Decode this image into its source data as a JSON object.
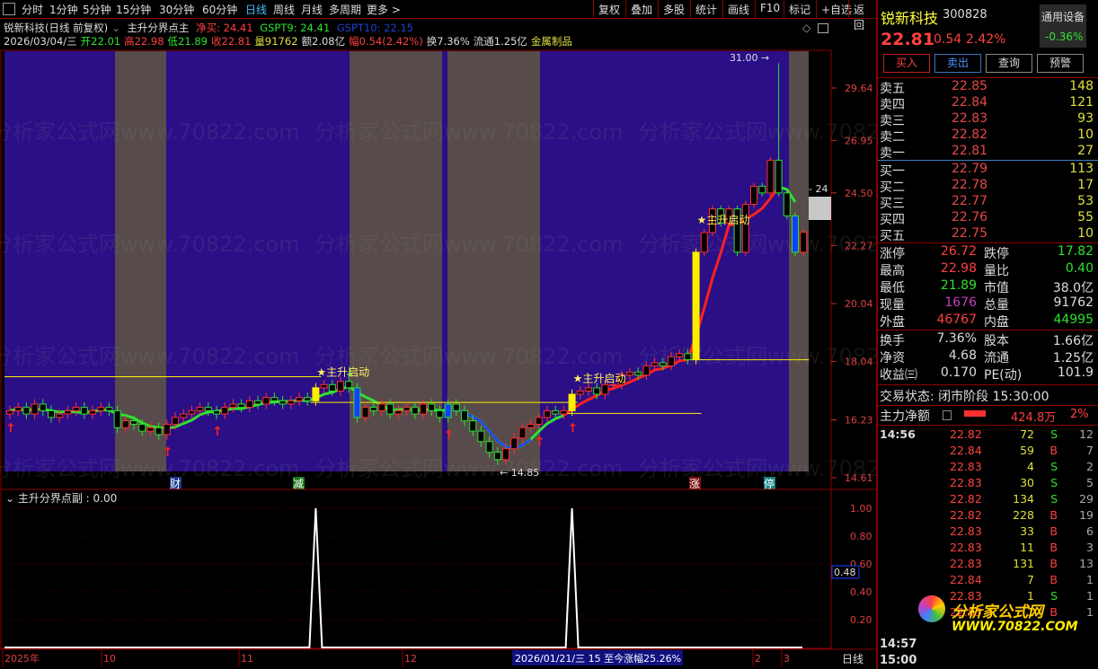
{
  "toolbar": {
    "periods": [
      "分时",
      "1分钟",
      "5分钟",
      "15分钟",
      "30分钟",
      "60分钟",
      "日线",
      "周线",
      "月线",
      "多周期",
      "更多 >"
    ],
    "active": "日线",
    "actions": [
      "复权",
      "叠加",
      "多股",
      "统计",
      "画线",
      "F10",
      "标记",
      "+自选",
      "返回"
    ]
  },
  "info": {
    "title": "锐新科技(日线 前复权)",
    "indicator": "主升分界点主",
    "jm": "净买: 24.41",
    "gspt9": "GSPT9: 24.41",
    "gspt10": "GSPT10: 22.15",
    "date": "2026/03/04/三",
    "open": "开22.01",
    "high": "高22.98",
    "low": "低21.89",
    "close": "收22.81",
    "vol": "量91762",
    "amount": "额2.08亿",
    "change": "幅0.54(2.42%)",
    "turnover": "换7.36%",
    "float": "流通1.25亿",
    "sector": "金属制品"
  },
  "chart_labels": {
    "signal": "★主升启动",
    "max_label": "31.00",
    "min_label": "← 14.85",
    "side_label": "- 24",
    "markers": [
      "财",
      "减",
      "涨",
      "停"
    ]
  },
  "sub": {
    "title": "主升分界点副 : 0.00",
    "current": "0.48",
    "ticks": [
      "1.00",
      "0.80",
      "0.60",
      "0.40",
      "0.20"
    ]
  },
  "axis": {
    "price_ticks": [
      "29.64",
      "26.95",
      "24.50",
      "22.27",
      "20.04",
      "18.04",
      "16.23",
      "14.61"
    ],
    "dates": [
      "2025年",
      "10",
      "11",
      "12",
      "2",
      "3"
    ],
    "cursor": "2026/01/21/三 15 至今涨幅25.26%",
    "period": "日线"
  },
  "watermark": "分析家公式网www.70822.com",
  "chart_data": {
    "type": "candlestick",
    "closes": [
      16.5,
      16.6,
      16.4,
      16.7,
      16.5,
      16.3,
      16.4,
      16.5,
      16.6,
      16.4,
      16.5,
      16.6,
      16.5,
      16.0,
      16.2,
      16.1,
      15.9,
      16.0,
      15.8,
      16.1,
      16.3,
      16.4,
      16.5,
      16.6,
      16.5,
      16.4,
      16.6,
      16.7,
      16.6,
      16.8,
      16.7,
      16.9,
      16.8,
      16.7,
      16.8,
      16.9,
      16.8,
      17.2,
      17.3,
      17.1,
      17.4,
      17.2,
      16.3,
      16.6,
      16.5,
      16.7,
      16.4,
      16.5,
      16.6,
      16.4,
      16.7,
      16.5,
      16.3,
      16.7,
      16.5,
      16.2,
      15.9,
      15.6,
      15.3,
      15.1,
      15.4,
      15.7,
      16.0,
      16.1,
      16.3,
      16.5,
      16.4,
      16.5,
      17.0,
      17.1,
      17.2,
      17.0,
      17.3,
      17.3,
      17.6,
      17.7,
      17.6,
      17.9,
      18.0,
      17.9,
      18.2,
      18.3,
      18.1,
      22.0,
      22.8,
      23.8,
      23.2,
      23.8,
      22.0,
      24.0,
      24.8,
      24.5,
      26.0,
      24.5,
      23.5,
      22.0,
      22.81
    ],
    "high_override": {
      "93": 31.0
    },
    "yellow": [
      37,
      68,
      83
    ],
    "blue": [
      42,
      53,
      95
    ],
    "up_arrows": [
      0,
      19,
      25,
      53,
      64,
      68
    ],
    "down_arrows": [
      41
    ],
    "signals": [
      37,
      68,
      83
    ],
    "levels": [
      [
        0,
        37,
        17.55
      ],
      [
        37,
        68,
        16.75
      ],
      [
        68,
        83,
        16.42
      ],
      [
        83,
        96,
        18.1
      ]
    ],
    "sub_spikes": [
      37,
      68
    ],
    "ylim": [
      14.61,
      29.64
    ]
  },
  "quote": {
    "name": "锐新科技",
    "code": "300828",
    "sector": "通用设备",
    "sector_chg": "-0.36%",
    "price": "22.81",
    "chg": "0.54",
    "pct": "2.42%",
    "buttons": [
      "买入",
      "卖出",
      "查询",
      "预警"
    ],
    "asks": [
      [
        "卖五",
        "22.85",
        "148"
      ],
      [
        "卖四",
        "22.84",
        "121"
      ],
      [
        "卖三",
        "22.83",
        "93"
      ],
      [
        "卖二",
        "22.82",
        "10"
      ],
      [
        "卖一",
        "22.81",
        "27"
      ]
    ],
    "bids": [
      [
        "买一",
        "22.79",
        "113"
      ],
      [
        "买二",
        "22.78",
        "17"
      ],
      [
        "买三",
        "22.77",
        "53"
      ],
      [
        "买四",
        "22.76",
        "55"
      ],
      [
        "买五",
        "22.75",
        "10"
      ]
    ],
    "stats": [
      [
        "涨停",
        "26.72",
        "跌停",
        "17.82"
      ],
      [
        "最高",
        "22.98",
        "量比",
        "0.40"
      ],
      [
        "最低",
        "21.89",
        "市值",
        "38.0亿"
      ],
      [
        "现量",
        "1676",
        "总量",
        "91762"
      ],
      [
        "外盘",
        "46767",
        "内盘",
        "44995"
      ]
    ],
    "stats2": [
      [
        "换手",
        "7.36%",
        "股本",
        "1.66亿"
      ],
      [
        "净资",
        "4.68",
        "流通",
        "1.25亿"
      ],
      [
        "收益㈢",
        "0.170",
        "PE(动)",
        "101.9"
      ]
    ],
    "status": "交易状态: 闭市阶段 15:30:00",
    "net_label": "主力净额",
    "net_value": "424.8万",
    "net_pct": "2%",
    "ticks": [
      [
        "14:56",
        "22.82",
        "72",
        "S",
        "12"
      ],
      [
        "",
        "22.84",
        "59",
        "B",
        "7"
      ],
      [
        "",
        "22.83",
        "4",
        "S",
        "2"
      ],
      [
        "",
        "22.83",
        "30",
        "S",
        "5"
      ],
      [
        "",
        "22.82",
        "134",
        "S",
        "29"
      ],
      [
        "",
        "22.82",
        "228",
        "B",
        "19"
      ],
      [
        "",
        "22.83",
        "33",
        "B",
        "6"
      ],
      [
        "",
        "22.83",
        "11",
        "B",
        "3"
      ],
      [
        "",
        "22.83",
        "131",
        "B",
        "13"
      ],
      [
        "",
        "22.84",
        "7",
        "B",
        "1"
      ],
      [
        "",
        "22.83",
        "1",
        "S",
        "1"
      ],
      [
        "",
        "22.83",
        "1",
        "B",
        "1"
      ]
    ],
    "times": [
      "14:57",
      "15:00"
    ],
    "logo": "分析家公式网",
    "logo_url": "WWW.70822.COM"
  }
}
